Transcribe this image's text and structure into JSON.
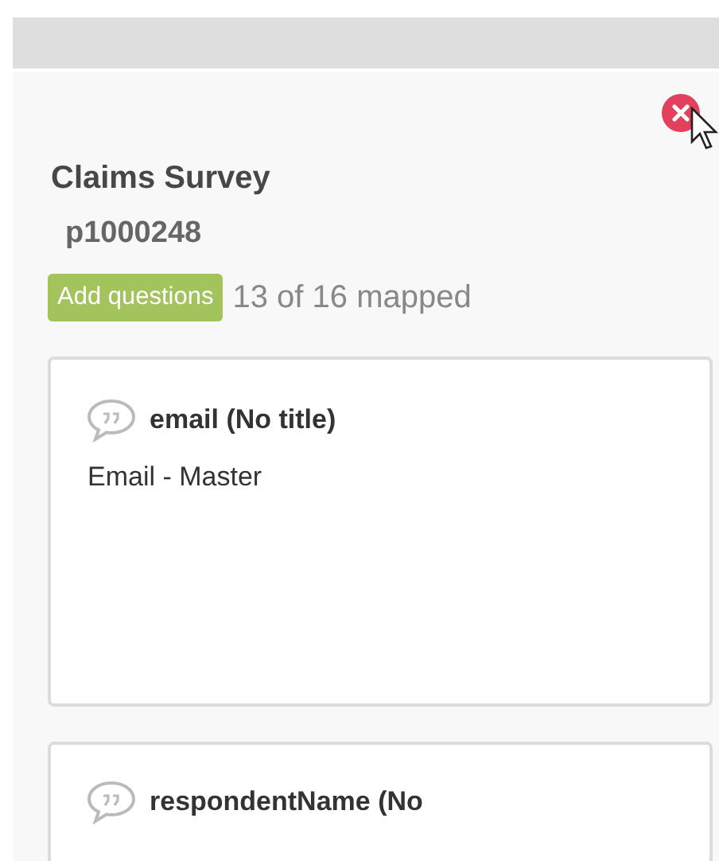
{
  "survey": {
    "title": "Claims Survey",
    "id": "p1000248"
  },
  "mapping": {
    "button": "Add questions",
    "status": "13 of 16 mapped"
  },
  "questions": [
    {
      "name": "email (No title)",
      "mapping": "Email - Master"
    },
    {
      "name": "respondentName (No"
    }
  ]
}
